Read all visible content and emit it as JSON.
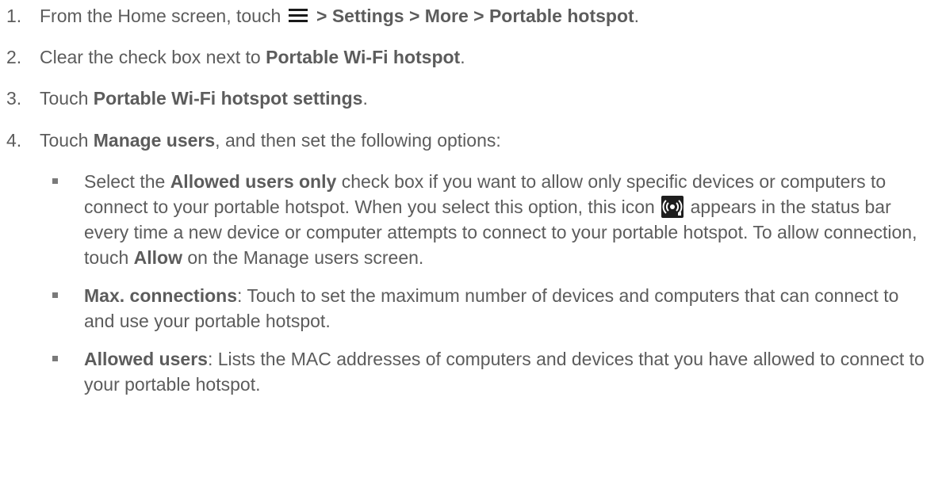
{
  "steps": [
    {
      "num": "1.",
      "pre": "From the Home screen, touch",
      "icon": "menu-icon",
      "path": "> Settings > More > Portable hotspot",
      "post": "."
    },
    {
      "num": "2.",
      "pre": "Clear the check box next to",
      "bold": "Portable Wi-Fi hotspot",
      "post": "."
    },
    {
      "num": "3.",
      "pre": "Touch",
      "bold": "Portable Wi-Fi hotspot settings",
      "post": "."
    },
    {
      "num": "4.",
      "pre": "Touch",
      "bold": "Manage users",
      "post": ", and then set the following options:"
    }
  ],
  "options": [
    {
      "pre": "Select the",
      "bold": "Allowed users only",
      "text1": "check box if you want to allow only specific devices or computers to connect to your portable hotspot. When you select this option, this icon",
      "icon": "hotspot-icon",
      "text2": "appears in the status bar every time a new device or computer attempts to connect to your portable hotspot. To allow connection, touch",
      "bold2": "Allow",
      "text3": "on the Manage users screen."
    },
    {
      "bold": "Max. connections",
      "text1": ": Touch to set the maximum number of devices and computers that can connect to and use your portable hotspot."
    },
    {
      "bold": "Allowed users",
      "text1": ": Lists the MAC addresses of computers and devices that you have allowed to connect to your portable hotspot."
    }
  ]
}
